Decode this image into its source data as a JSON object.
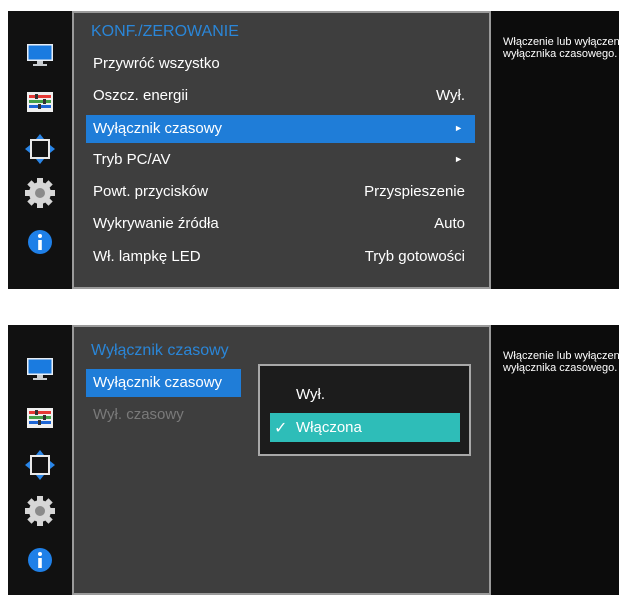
{
  "panel1": {
    "menu_title": "KONF./ZEROWANIE",
    "items": [
      {
        "label": "Przywróć wszystko",
        "value": "",
        "arrow": ""
      },
      {
        "label": "Oszcz. energii",
        "value": "Wył.",
        "arrow": ""
      },
      {
        "label": "Wyłącznik czasowy",
        "value": "",
        "arrow": "►"
      },
      {
        "label": "Tryb PC/AV",
        "value": "",
        "arrow": "►"
      },
      {
        "label": "Powt. przycisków",
        "value": "Przyspieszenie",
        "arrow": ""
      },
      {
        "label": "Wykrywanie źródła",
        "value": "Auto",
        "arrow": ""
      },
      {
        "label": "Wł. lampkę LED",
        "value": "Tryb gotowości",
        "arrow": ""
      }
    ],
    "help_text": "Włączenie lub wyłączenie wyłącznika czasowego."
  },
  "panel2": {
    "menu_title": "Wyłącznik czasowy",
    "items": [
      {
        "label": "Wyłącznik czasowy"
      },
      {
        "label": "Wył. czasowy"
      }
    ],
    "popup": {
      "options": [
        {
          "label": "Wył."
        },
        {
          "label": "Włączona",
          "check": "✓"
        }
      ],
      "selected_index": 1
    },
    "help_text": "Włączenie lub wyłączenie wyłącznika czasowego."
  },
  "sidebar_icons": [
    "monitor-icon",
    "color-icon",
    "size-position-icon",
    "settings-gear-icon",
    "information-icon"
  ],
  "colors": {
    "selection_blue": "#1f7dd8",
    "option_teal": "#2ebdb8",
    "title_blue": "#2a86d8",
    "menu_bg": "#3e3e3e"
  }
}
